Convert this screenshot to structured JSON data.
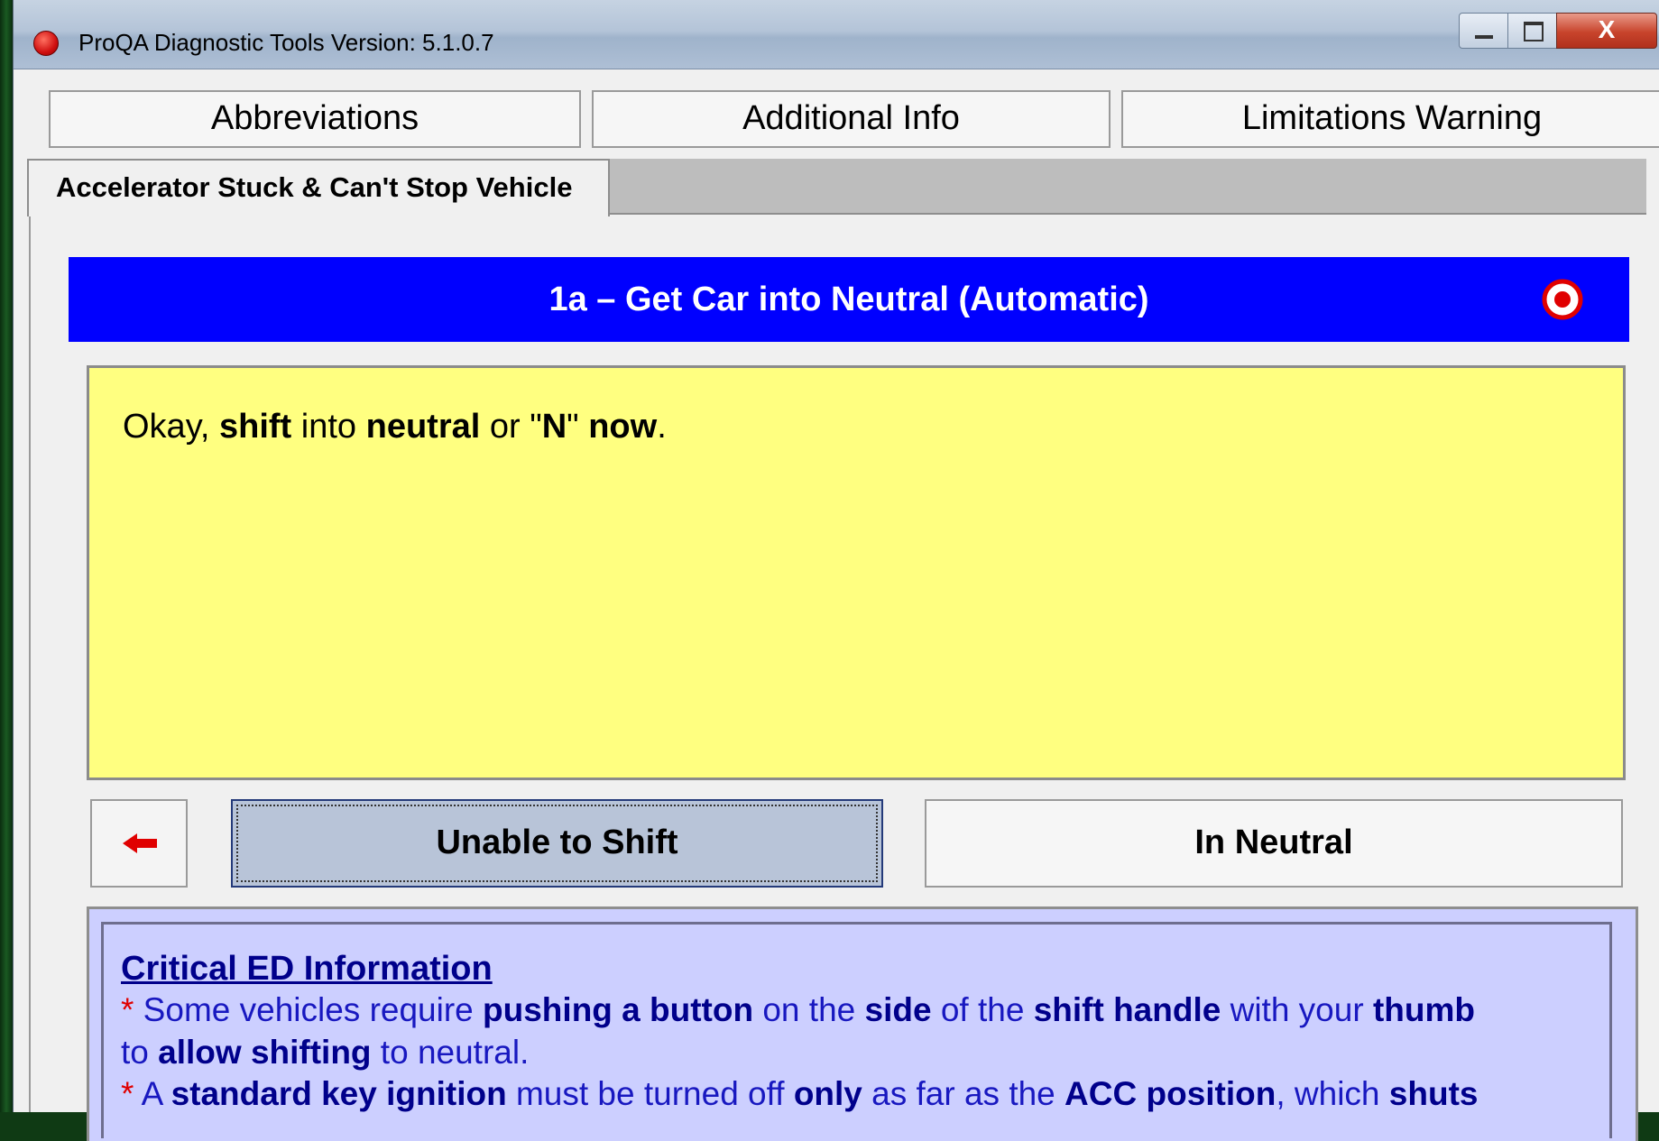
{
  "window": {
    "title": "ProQA Diagnostic Tools Version: 5.1.0.7",
    "close_glyph": "X"
  },
  "top_buttons": {
    "abbreviations": "Abbreviations",
    "additional_info": "Additional Info",
    "limitations_warning": "Limitations Warning"
  },
  "tab": {
    "label": "Accelerator Stuck & Can't Stop Vehicle"
  },
  "header": {
    "title": "1a – Get Car into Neutral (Automatic)"
  },
  "question": {
    "p1": "Okay, ",
    "b1": "shift",
    "p2": " into ",
    "b2": "neutral",
    "p3": " or \"",
    "b3": "N",
    "p4": "\" ",
    "b4": "now",
    "p5": "."
  },
  "answers": {
    "unable_to_shift": "Unable to Shift",
    "in_neutral": "In Neutral"
  },
  "info": {
    "title": "Critical ED Information",
    "line1": {
      "star": "*",
      "t1": " Some vehicles require ",
      "b1": "pushing a button",
      "t2": " on the ",
      "b2": "side",
      "t3": " of the ",
      "b3": "shift handle",
      "t4": " with your ",
      "b4": "thumb"
    },
    "line2": {
      "t1": "to ",
      "b1": "allow shifting",
      "t2": " to neutral."
    },
    "line3": {
      "star": "*",
      "t1": " A ",
      "b1": "standard key ignition",
      "t2": " must be turned off ",
      "b2": "only",
      "t3": " as far as the ",
      "b3": "ACC position",
      "t4": ", which ",
      "b4": "shuts"
    }
  },
  "colors": {
    "header_blue": "#0000ff",
    "question_yellow": "#ffff80",
    "info_lavender": "#cccfff",
    "target_red": "#e00000"
  },
  "icons": {
    "window_logo": "red-circle-icon",
    "target": "target-icon",
    "back": "left-arrow-icon"
  }
}
